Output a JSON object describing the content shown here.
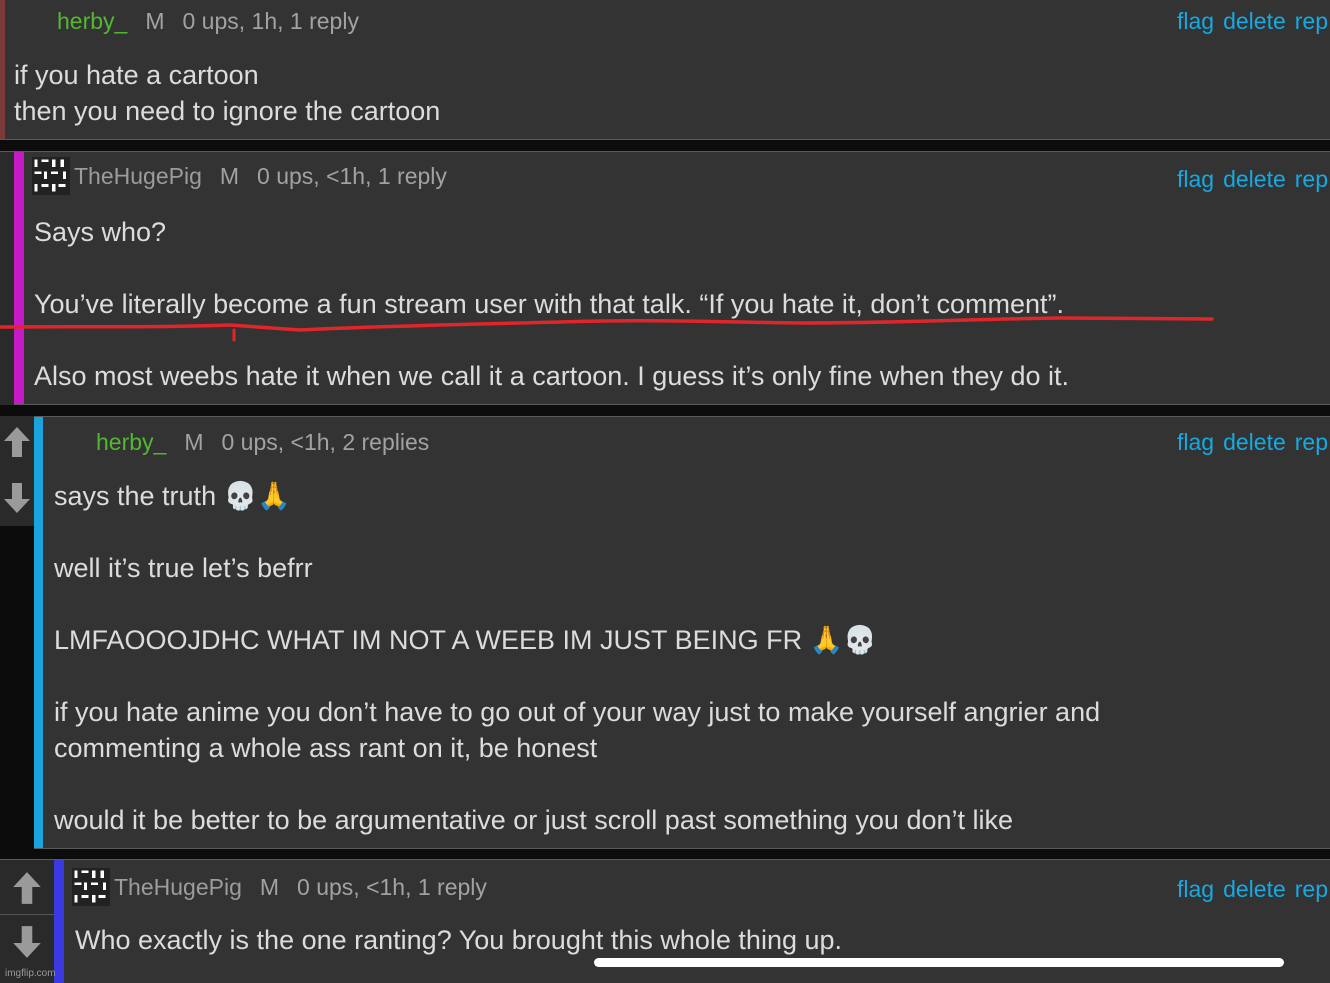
{
  "comments": [
    {
      "username": "herby_",
      "badge": "M",
      "meta": "0 ups, 1h, 1 reply",
      "actions": {
        "flag": "flag",
        "delete": "delete",
        "reply": "rep"
      },
      "lines": [
        "if you hate a cartoon",
        "then you need to ignore the cartoon"
      ]
    },
    {
      "username": "TheHugePig",
      "badge": "M",
      "meta": "0 ups, <1h, 1 reply",
      "actions": {
        "flag": "flag",
        "delete": "delete",
        "reply": "rep"
      },
      "lines": [
        "Says who?",
        "You’ve literally become a fun stream user with that talk. “If you hate it, don’t comment”.",
        "Also most weebs hate it when we call it a cartoon. I guess it’s only fine when they do it."
      ]
    },
    {
      "username": "herby_",
      "badge": "M",
      "meta": "0 ups, <1h, 2 replies",
      "actions": {
        "flag": "flag",
        "delete": "delete",
        "reply": "rep"
      },
      "lines": [
        "says the truth 💀🙏",
        "well it’s true let’s befrr",
        "LMFAOOOJDHC WHAT IM NOT A WEEB IM JUST BEING FR 🙏💀",
        "if you hate anime you don’t have to go out of your way just to make yourself angrier and",
        "commenting a whole ass rant on it, be honest",
        "would it be better to be argumentative or just scroll past something you don’t like"
      ]
    },
    {
      "username": "TheHugePig",
      "badge": "M",
      "meta": "0 ups, <1h, 1 reply",
      "actions": {
        "flag": "flag",
        "delete": "delete",
        "reply": "rep"
      },
      "lines": [
        "Who exactly is the one ranting? You brought this whole thing up."
      ]
    }
  ],
  "icons": {
    "upvote": "up-arrow-icon",
    "downvote": "down-arrow-icon",
    "avatar": "qr-avatar-icon"
  },
  "colors": {
    "bar1": "#7a3a3a",
    "bar2": "#c61ac6",
    "bar3": "#1aa3dd",
    "bar4": "#3a3ae0",
    "username_green": "#52b830",
    "link": "#16a9e2",
    "annotation_red": "#e0262a"
  },
  "watermark": "imgflip.com"
}
